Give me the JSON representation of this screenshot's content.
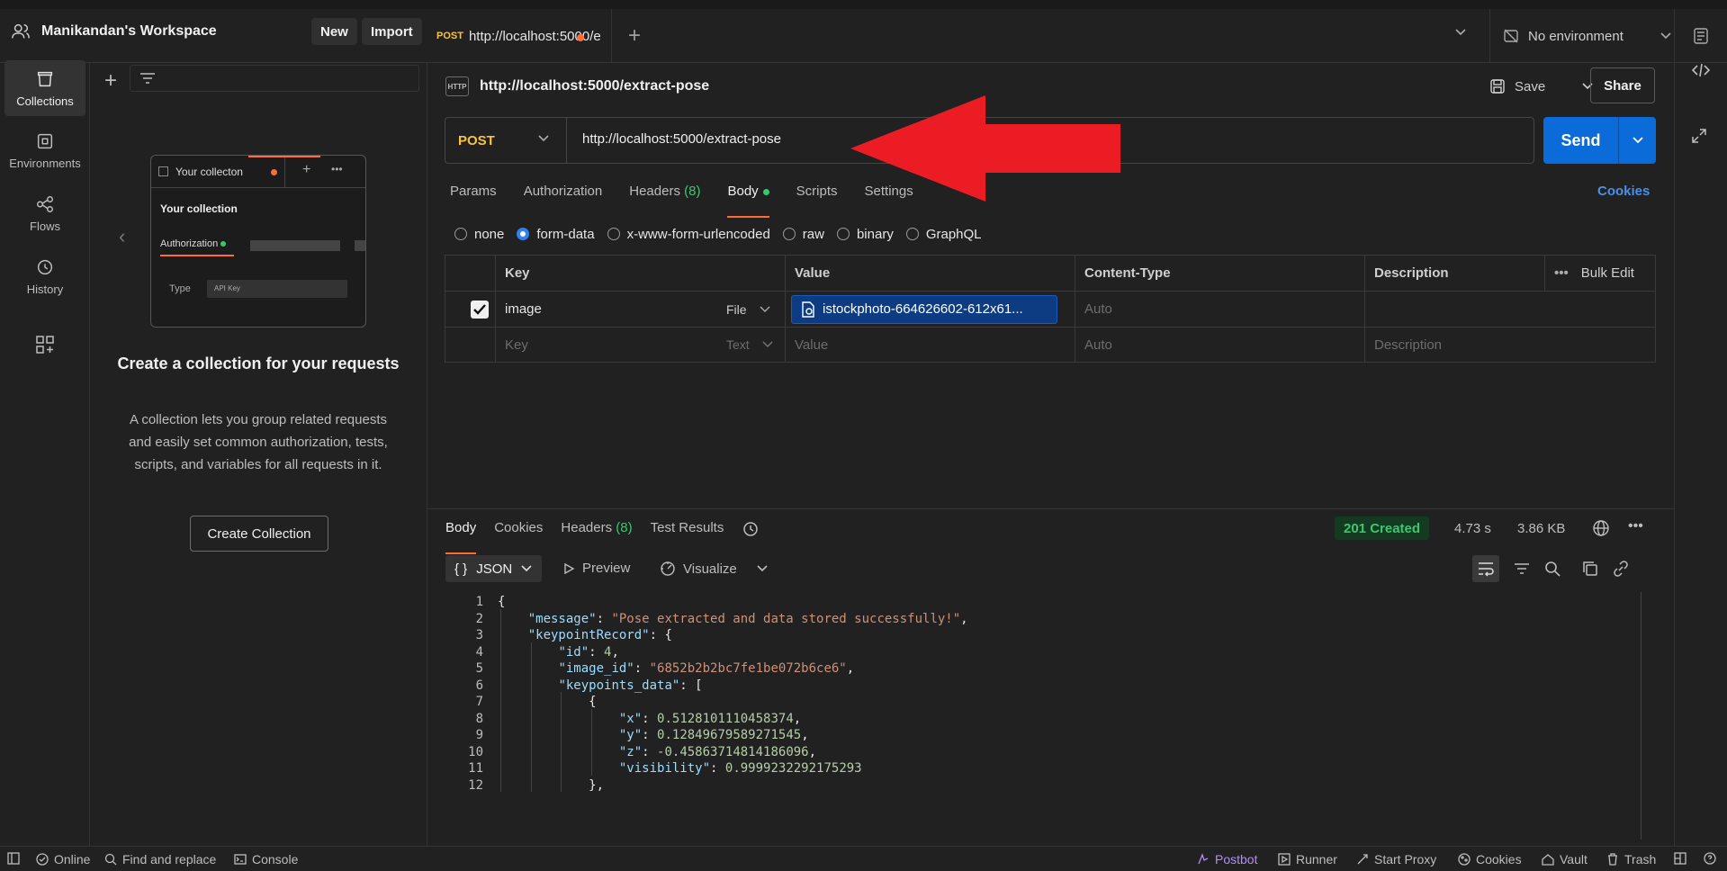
{
  "workspace": {
    "name": "Manikandan's Workspace",
    "new_label": "New",
    "import_label": "Import"
  },
  "tabs": [
    {
      "method": "POST",
      "url": "http://localhost:5000/e"
    }
  ],
  "environment": {
    "label": "No environment"
  },
  "rail": [
    {
      "label": "Collections",
      "icon": "collections-icon"
    },
    {
      "label": "Environments",
      "icon": "environments-icon"
    },
    {
      "label": "Flows",
      "icon": "flows-icon"
    },
    {
      "label": "History",
      "icon": "history-icon"
    }
  ],
  "collections_panel": {
    "illus_tab": "Your collecton",
    "illus_heading": "Your collection",
    "illus_auth": "Authorization",
    "illus_type": "Type",
    "illus_select": "API Key",
    "title": "Create a collection for your requests",
    "description": "A collection lets you group related requests and easily set common authorization, tests, scripts, and variables for all requests in it.",
    "create_label": "Create Collection"
  },
  "request": {
    "title": "http://localhost:5000/extract-pose",
    "http_badge": "HTTP",
    "save_label": "Save",
    "share_label": "Share",
    "method": "POST",
    "url": "http://localhost:5000/extract-pose",
    "send_label": "Send",
    "tabs": {
      "params": "Params",
      "authorization": "Authorization",
      "headers": "Headers",
      "headers_count": "(8)",
      "body": "Body",
      "scripts": "Scripts",
      "settings": "Settings"
    },
    "cookies_label": "Cookies",
    "body_modes": [
      "none",
      "form-data",
      "x-www-form-urlencoded",
      "raw",
      "binary",
      "GraphQL"
    ],
    "selected_mode": "form-data",
    "table": {
      "headers": {
        "key": "Key",
        "value": "Value",
        "content_type": "Content-Type",
        "description": "Description",
        "bulk_edit": "Bulk Edit"
      },
      "row1": {
        "key": "image",
        "type": "File",
        "value": "istockphoto-664626602-612x61...",
        "content_type": "Auto"
      },
      "row2": {
        "key": "Key",
        "type": "Text",
        "value": "Value",
        "content_type": "Auto",
        "description": "Description"
      }
    }
  },
  "response": {
    "tabs": {
      "body": "Body",
      "cookies": "Cookies",
      "headers": "Headers",
      "headers_count": "(8)",
      "tests": "Test Results"
    },
    "status": "201 Created",
    "time": "4.73 s",
    "size": "3.86 KB",
    "format": "JSON",
    "preview_label": "Preview",
    "visualize_label": "Visualize",
    "lines": [
      {
        "n": "1",
        "indent": 0,
        "text": "{"
      },
      {
        "n": "2",
        "indent": 1,
        "key": "\"message\"",
        "val": "\"Pose extracted and data stored successfully!\"",
        "vtype": "s",
        "tail": ","
      },
      {
        "n": "3",
        "indent": 1,
        "key": "\"keypointRecord\"",
        "val": "{",
        "vtype": "p",
        "tail": ""
      },
      {
        "n": "4",
        "indent": 2,
        "key": "\"id\"",
        "val": "4",
        "vtype": "n",
        "tail": ","
      },
      {
        "n": "5",
        "indent": 2,
        "key": "\"image_id\"",
        "val": "\"6852b2b2bc7fe1be072b6ce6\"",
        "vtype": "s",
        "tail": ","
      },
      {
        "n": "6",
        "indent": 2,
        "key": "\"keypoints_data\"",
        "val": "[",
        "vtype": "p",
        "tail": ""
      },
      {
        "n": "7",
        "indent": 3,
        "text": "{"
      },
      {
        "n": "8",
        "indent": 4,
        "key": "\"x\"",
        "val": "0.5128101110458374",
        "vtype": "n",
        "tail": ","
      },
      {
        "n": "9",
        "indent": 4,
        "key": "\"y\"",
        "val": "0.12849679589271545",
        "vtype": "n",
        "tail": ","
      },
      {
        "n": "10",
        "indent": 4,
        "key": "\"z\"",
        "val": "-0.45863714814186096",
        "vtype": "n",
        "tail": ","
      },
      {
        "n": "11",
        "indent": 4,
        "key": "\"visibility\"",
        "val": "0.9999232292175293",
        "vtype": "n",
        "tail": ""
      },
      {
        "n": "12",
        "indent": 3,
        "text": "},"
      }
    ]
  },
  "statusbar": {
    "online": "Online",
    "find": "Find and replace",
    "console": "Console",
    "postbot": "Postbot",
    "runner": "Runner",
    "proxy": "Start Proxy",
    "cookies": "Cookies",
    "vault": "Vault",
    "trash": "Trash"
  },
  "colors": {
    "accent": "#ff6c37",
    "send": "#0b6bd8",
    "method": "#f5c542",
    "success": "#3cc76f"
  }
}
